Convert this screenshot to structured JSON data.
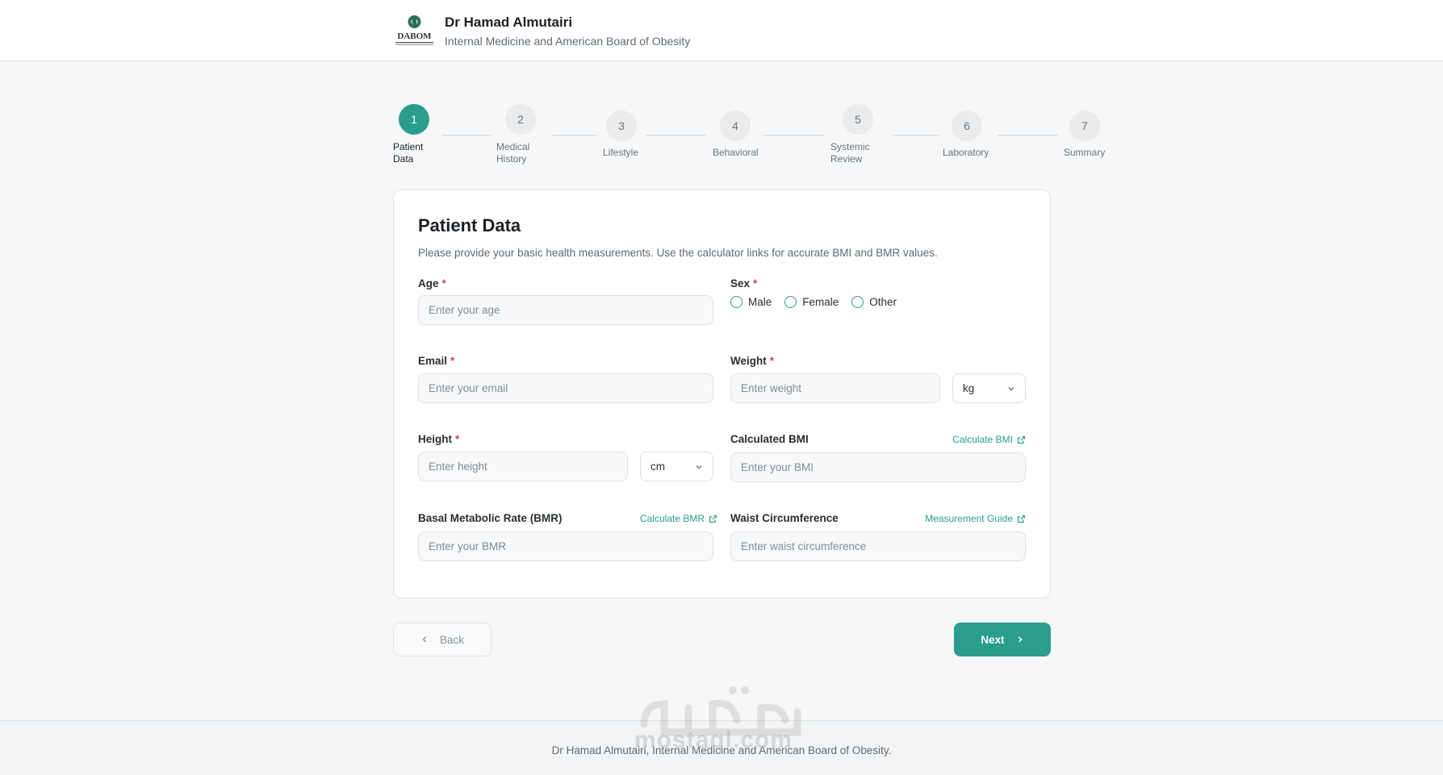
{
  "header": {
    "doctor_name": "Dr Hamad Almutairi",
    "subtitle": "Internal Medicine and American Board of Obesity",
    "logo_text": "DABOM"
  },
  "stepper": {
    "steps": [
      {
        "number": "1",
        "label": "Patient\nData",
        "active": true
      },
      {
        "number": "2",
        "label": "Medical\nHistory",
        "active": false
      },
      {
        "number": "3",
        "label": "Lifestyle",
        "active": false
      },
      {
        "number": "4",
        "label": "Behavioral",
        "active": false
      },
      {
        "number": "5",
        "label": "Systemic\nReview",
        "active": false
      },
      {
        "number": "6",
        "label": "Laboratory",
        "active": false
      },
      {
        "number": "7",
        "label": "Summary",
        "active": false
      }
    ]
  },
  "form": {
    "title": "Patient Data",
    "description": "Please provide your basic health measurements. Use the calculator links for accurate BMI and BMR values.",
    "required_mark": "*",
    "age": {
      "label": "Age",
      "placeholder": "Enter your age",
      "value": ""
    },
    "sex": {
      "label": "Sex",
      "options": [
        "Male",
        "Female",
        "Other"
      ],
      "selected": ""
    },
    "email": {
      "label": "Email",
      "placeholder": "Enter your email",
      "value": ""
    },
    "weight": {
      "label": "Weight",
      "placeholder": "Enter weight",
      "value": "",
      "unit": "kg"
    },
    "height": {
      "label": "Height",
      "placeholder": "Enter height",
      "value": "",
      "unit": "cm"
    },
    "bmi": {
      "label": "Calculated BMI",
      "placeholder": "Enter your BMI",
      "value": "",
      "link": "Calculate BMI"
    },
    "bmr": {
      "label": "Basal Metabolic Rate (BMR)",
      "placeholder": "Enter your BMR",
      "value": "",
      "link": "Calculate BMR"
    },
    "waist": {
      "label": "Waist Circumference",
      "placeholder": "Enter waist circumference",
      "value": "",
      "link": "Measurement Guide"
    }
  },
  "nav": {
    "back_label": "Back",
    "next_label": "Next"
  },
  "footer": {
    "text": "Dr Hamad Almutairi, Internal Medicine and American Board of Obesity."
  },
  "watermark": {
    "text": "mostaql.com"
  },
  "colors": {
    "accent": "#2a9d8f",
    "required": "#d64545"
  }
}
